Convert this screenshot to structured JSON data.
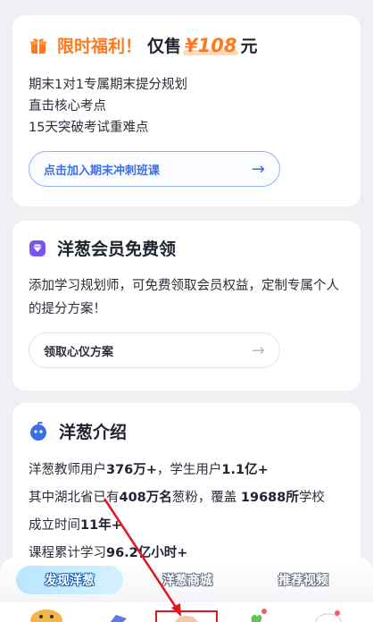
{
  "promo": {
    "label": "限时福利！",
    "sale_prefix": "仅售",
    "price": "¥108",
    "unit": "元",
    "lines": [
      "期末1对1专属期末提分规划",
      "直击核心考点",
      "15天突破考试重难点"
    ],
    "button_label": "点击加入期末冲刺班课"
  },
  "vip": {
    "title": "洋葱会员免费领",
    "description": "添加学习规划师，可免费领取会员权益，定制专属个人的提分方案！",
    "button_label": "领取心仪方案"
  },
  "intro": {
    "title": "洋葱介绍",
    "line1": {
      "a": "洋葱教师用户",
      "b": "376万+",
      "c": "，学生用户",
      "d": "1.1亿+"
    },
    "line2": {
      "a": "其中湖北省已有",
      "b": "408万名",
      "c": "葱粉，覆盖 ",
      "d": "19688所",
      "e": "学校"
    },
    "line3": {
      "a": "成立时间",
      "b": "11年",
      "c": "+"
    },
    "line4": {
      "a": "课程累计学习",
      "b": "96.2亿小时+"
    }
  },
  "tabs": [
    "发现洋葱",
    "洋葱商城",
    "推荐视频"
  ],
  "colors": {
    "accent_orange": "#ff7a1f",
    "accent_blue": "#3a6fe6",
    "annotation_red": "#e0181b"
  }
}
